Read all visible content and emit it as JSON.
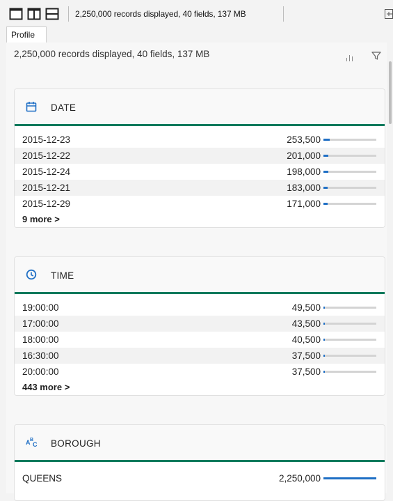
{
  "toolbar": {
    "status_text": "2,250,000 records displayed, 40 fields, 137 MB",
    "buttons": [
      {
        "name": "single-pane-layout-icon"
      },
      {
        "name": "split-vertical-layout-icon"
      },
      {
        "name": "split-horizontal-layout-icon"
      }
    ],
    "right_icon": "export-icon"
  },
  "tabs": [
    {
      "label": "Profile",
      "active": true
    }
  ],
  "summary": "2,250,000 records displayed, 40 fields, 137 MB",
  "summary_icons": [
    "bar-chart-icon",
    "filter-icon"
  ],
  "colors": {
    "accent": "#0e7a5c",
    "bar_fill": "#1f6fc5",
    "bar_track": "#d4d4d4"
  },
  "cards": [
    {
      "title": "DATE",
      "icon": "calendar-icon",
      "rows": [
        {
          "label": "2015-12-23",
          "count": "253,500",
          "fraction": 0.113
        },
        {
          "label": "2015-12-22",
          "count": "201,000",
          "fraction": 0.089
        },
        {
          "label": "2015-12-24",
          "count": "198,000",
          "fraction": 0.088
        },
        {
          "label": "2015-12-21",
          "count": "183,000",
          "fraction": 0.081
        },
        {
          "label": "2015-12-29",
          "count": "171,000",
          "fraction": 0.076
        }
      ],
      "more": "9 more >"
    },
    {
      "title": "TIME",
      "icon": "clock-icon",
      "rows": [
        {
          "label": "19:00:00",
          "count": "49,500",
          "fraction": 0.022
        },
        {
          "label": "17:00:00",
          "count": "43,500",
          "fraction": 0.019
        },
        {
          "label": "18:00:00",
          "count": "40,500",
          "fraction": 0.018
        },
        {
          "label": "16:30:00",
          "count": "37,500",
          "fraction": 0.017
        },
        {
          "label": "20:00:00",
          "count": "37,500",
          "fraction": 0.017
        }
      ],
      "more": "443 more >"
    },
    {
      "title": "BOROUGH",
      "icon": "text-type-icon",
      "rows": [
        {
          "label": "QUEENS",
          "count": "2,250,000",
          "fraction": 1.0
        }
      ],
      "more": ""
    }
  ]
}
